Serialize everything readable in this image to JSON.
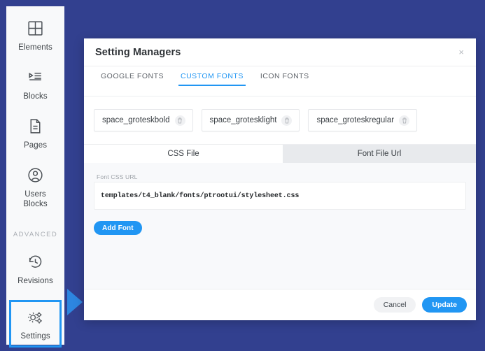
{
  "theme": {
    "page_background": "#32408f",
    "sidebar_background": "#f8f9fa",
    "accent_blue": "#2196f3",
    "arrow_blue": "#2d86e0",
    "subtab_inactive": "#e8eaed",
    "panel_background": "#f8f9fb"
  },
  "sidebar": {
    "items": [
      {
        "label": "Elements",
        "icon": "grid-icon"
      },
      {
        "label": "Blocks",
        "icon": "list-blocks-icon"
      },
      {
        "label": "Pages",
        "icon": "document-icon"
      },
      {
        "label": "Users\nBlocks",
        "icon": "user-circle-icon",
        "label_line1": "Users",
        "label_line2": "Blocks"
      }
    ],
    "section_label": "ADVANCED",
    "advanced_items": [
      {
        "label": "Revisions",
        "icon": "history-clock-icon"
      },
      {
        "label": "Settings",
        "icon": "gears-icon",
        "selected": true
      }
    ],
    "pointer_icon": "right-arrow-pointer"
  },
  "modal": {
    "title": "Setting Managers",
    "close_label": "×",
    "tabs": [
      {
        "label": "GOOGLE FONTS",
        "active": false
      },
      {
        "label": "CUSTOM FONTS",
        "active": true
      },
      {
        "label": "ICON FONTS",
        "active": false
      }
    ],
    "font_chips": [
      {
        "name": "space_groteskbold",
        "delete_icon": "trash-icon"
      },
      {
        "name": "space_grotesklight",
        "delete_icon": "trash-icon"
      },
      {
        "name": "space_groteskregular",
        "delete_icon": "trash-icon"
      }
    ],
    "subtabs": [
      {
        "label": "CSS File",
        "active": true
      },
      {
        "label": "Font File Url",
        "active": false
      }
    ],
    "field": {
      "label": "Font CSS URL",
      "value": "templates/t4_blank/fonts/ptrootui/stylesheet.css",
      "placeholder": "Font CSS URL"
    },
    "add_font_label": "Add Font",
    "footer": {
      "cancel_label": "Cancel",
      "update_label": "Update"
    }
  }
}
